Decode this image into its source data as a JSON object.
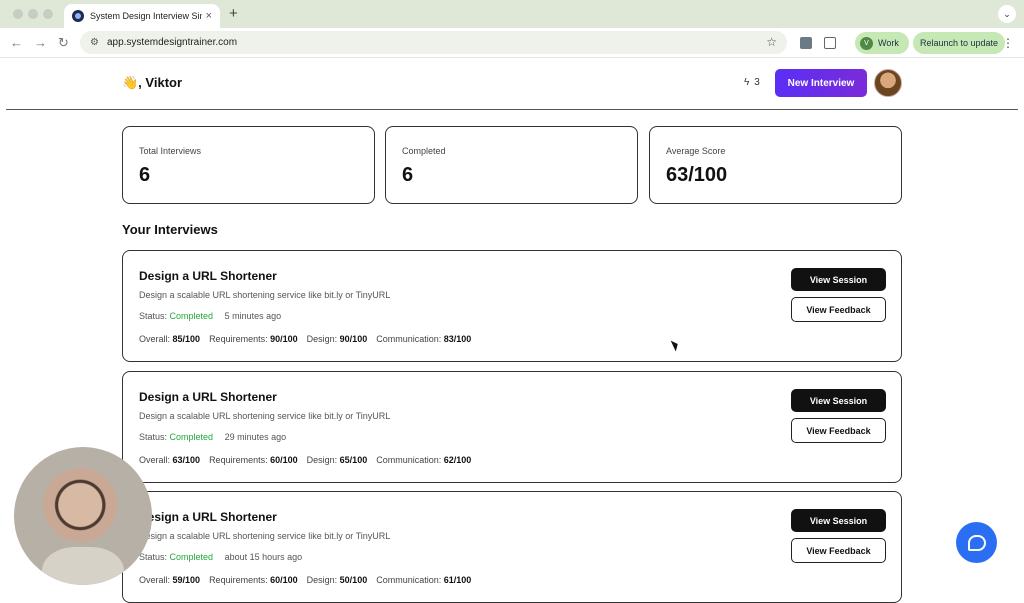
{
  "browser": {
    "tab_title": "System Design Interview Sim",
    "tab_close": "×",
    "new_tab": "+",
    "tab_menu": "⌄",
    "url": "app.systemdesigntrainer.com",
    "profile_initial": "V",
    "profile_label": "Work",
    "relaunch_label": "Relaunch to update",
    "back_icon": "←",
    "forward_icon": "→",
    "reload_icon": "↻",
    "site_info_icon": "⚙",
    "star_icon": "☆",
    "kebab_icon": "⋮"
  },
  "header": {
    "greeting": "👋, Viktor",
    "streak_icon": "ϟ",
    "streak_count": "3",
    "new_interview_label": "New Interview"
  },
  "stats": [
    {
      "label": "Total Interviews",
      "value": "6"
    },
    {
      "label": "Completed",
      "value": "6"
    },
    {
      "label": "Average Score",
      "value": "63/100"
    }
  ],
  "section_title": "Your Interviews",
  "labels": {
    "status": "Status:",
    "overall": "Overall:",
    "requirements": "Requirements:",
    "design": "Design:",
    "communication": "Communication:",
    "view_session": "View Session",
    "view_feedback": "View Feedback"
  },
  "interviews": [
    {
      "title": "Design a URL Shortener",
      "description": "Design a scalable URL shortening service like bit.ly or TinyURL",
      "status": "Completed",
      "time": "5 minutes ago",
      "overall": "85/100",
      "requirements": "90/100",
      "design": "90/100",
      "communication": "83/100"
    },
    {
      "title": "Design a URL Shortener",
      "description": "Design a scalable URL shortening service like bit.ly or TinyURL",
      "status": "Completed",
      "time": "29 minutes ago",
      "overall": "63/100",
      "requirements": "60/100",
      "design": "65/100",
      "communication": "62/100"
    },
    {
      "title": "Design a URL Shortener",
      "description": "Design a scalable URL shortening service like bit.ly or TinyURL",
      "status": "Completed",
      "time": "about 15 hours ago",
      "overall": "59/100",
      "requirements": "60/100",
      "design": "50/100",
      "communication": "61/100"
    }
  ],
  "colors": {
    "accent_start": "#5a2ff5",
    "accent_end": "#7a2bd9",
    "status_completed": "#22a83a",
    "chat_launcher": "#2a6ff3"
  }
}
